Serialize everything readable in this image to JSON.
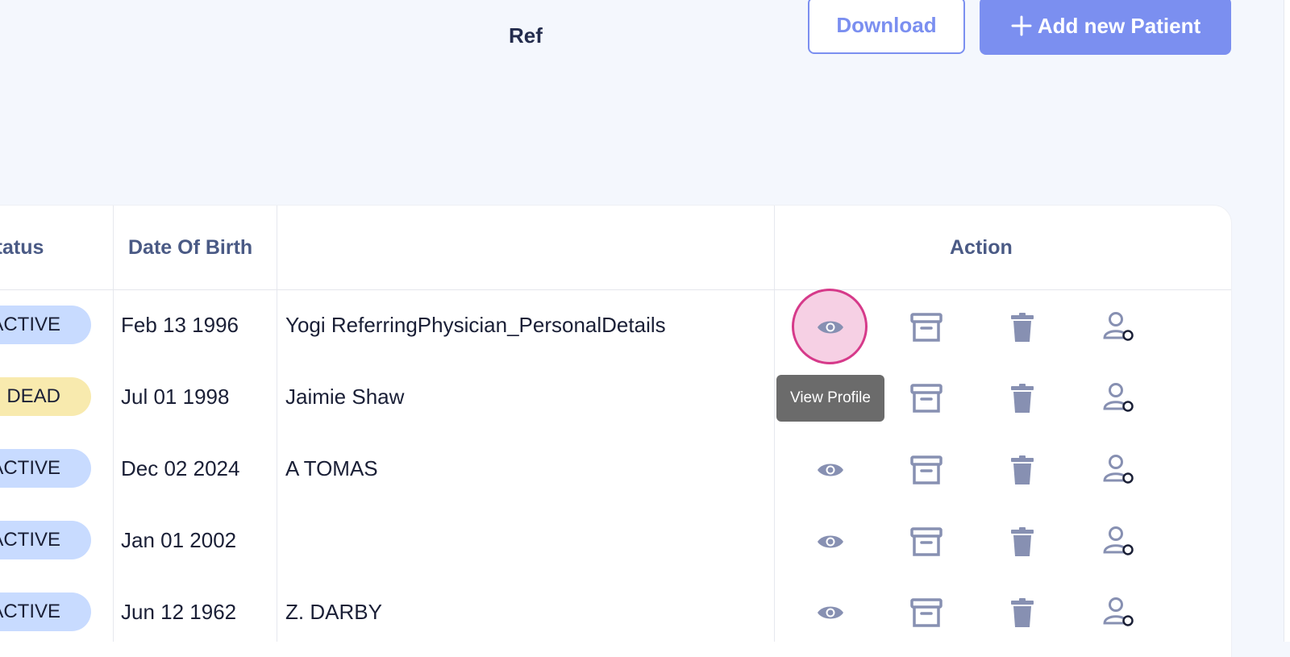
{
  "toolbar": {
    "download_label": "Download",
    "add_label": "Add new Patient"
  },
  "table": {
    "headers": {
      "status": "Status",
      "dob": "Date Of Birth",
      "ref": "Ref",
      "action": "Action"
    },
    "rows": [
      {
        "status": "ACTIVE",
        "dob": "Feb 13 1996",
        "ref": "Yogi ReferringPhysician_PersonalDetails"
      },
      {
        "status": "DEAD",
        "dob": "Jul 01 1998",
        "ref": "Jaimie Shaw"
      },
      {
        "status": "ACTIVE",
        "dob": "Dec 02 2024",
        "ref": "A TOMAS"
      },
      {
        "status": "ACTIVE",
        "dob": "Jan 01 2002",
        "ref": ""
      },
      {
        "status": "ACTIVE",
        "dob": "Jun 12 1962",
        "ref": "Z. DARBY"
      }
    ],
    "action_icons": [
      "eye-icon",
      "archive-icon",
      "trash-icon",
      "user-settings-icon"
    ]
  },
  "tooltip": {
    "text": "View Profile"
  },
  "colors": {
    "accent": "#7b8ff0",
    "background": "#f4f7fd",
    "active_badge": "#c8dbff",
    "dead_badge": "#f8eaae",
    "icon": "#8790b2",
    "focus_ring": "#d63a8a",
    "header_text": "#4a5a85"
  }
}
